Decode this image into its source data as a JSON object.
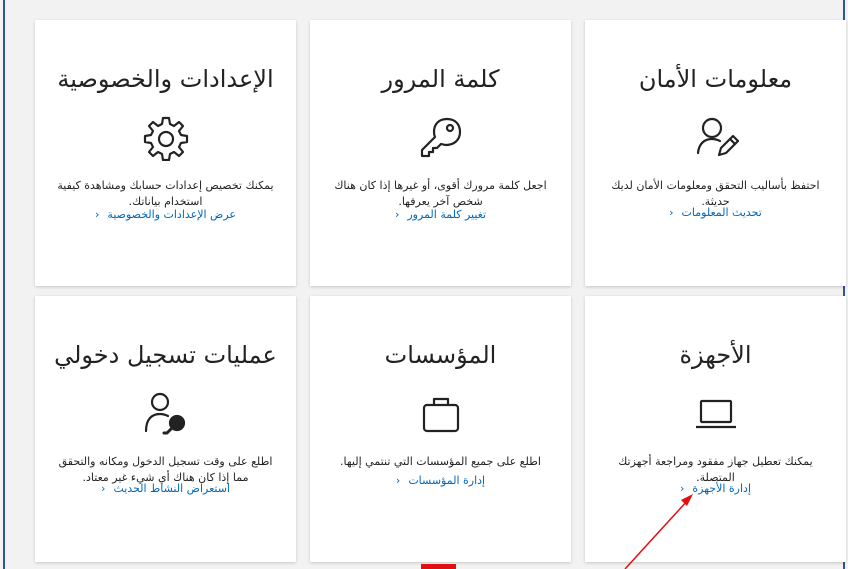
{
  "cards": [
    {
      "title": "معلومات الأمان",
      "icon": "user-edit-icon",
      "description": "احتفظ بأساليب التحقق ومعلومات الأمان لديك حديثة.",
      "link": "تحديث المعلومات"
    },
    {
      "title": "كلمة المرور",
      "icon": "key-icon",
      "description": "اجعل كلمة مرورك أقوى، أو غيرها إذا كان هناك شخص آخر يعرفها.",
      "link": "تغيير كلمة المرور"
    },
    {
      "title": "الإعدادات والخصوصية",
      "icon": "gear-icon",
      "description": "يمكنك تخصيص إعدادات حسابك ومشاهدة كيفية استخدام بياناتك.",
      "link": "عرض الإعدادات والخصوصية"
    },
    {
      "title": "الأجهزة",
      "icon": "laptop-icon",
      "description": "يمكنك تعطيل جهاز مفقود ومراجعة أجهزتك المتصلة.",
      "link": "إدارة الأجهزة"
    },
    {
      "title": "المؤسسات",
      "icon": "briefcase-icon",
      "description": "اطلع على جميع المؤسسات التي تنتمي إليها.",
      "link": "إدارة المؤسسات"
    },
    {
      "title": "عمليات تسجيل دخولي",
      "icon": "user-key-icon",
      "description": "اطلع على وقت تسجيل الدخول ومكانه والتحقق مما إذا كان هناك أي شيء غير معتاد.",
      "link": "استعراض النشاط الحديث"
    }
  ],
  "chevron": "‹",
  "colors": {
    "link": "#0067b8",
    "frame": "#2f5597",
    "annotation": "#e01010"
  }
}
